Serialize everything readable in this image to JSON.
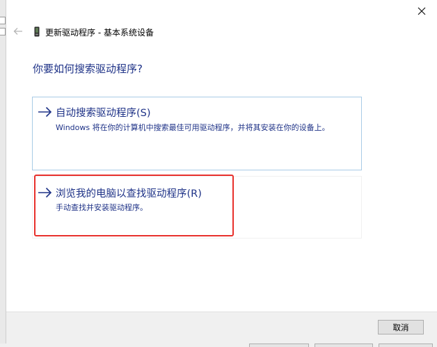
{
  "window": {
    "title": "更新驱动程序 - 基本系统设备",
    "heading": "你要如何搜索驱动程序?"
  },
  "options": [
    {
      "title": "自动搜索驱动程序(S)",
      "description": "Windows 将在你的计算机中搜索最佳可用驱动程序，并将其安装在你的设备上。",
      "icon": "arrow-right-icon"
    },
    {
      "title": "浏览我的电脑以查找驱动程序(R)",
      "description": "手动查找并安装驱动程序。",
      "icon": "arrow-right-icon",
      "highlighted": true
    }
  ],
  "footer": {
    "cancel_label": "取消"
  },
  "colors": {
    "link_blue": "#1e3287",
    "option_border": "#a8cbe6",
    "highlight_red": "#e8302b",
    "footer_bg": "#f0f0f0"
  }
}
